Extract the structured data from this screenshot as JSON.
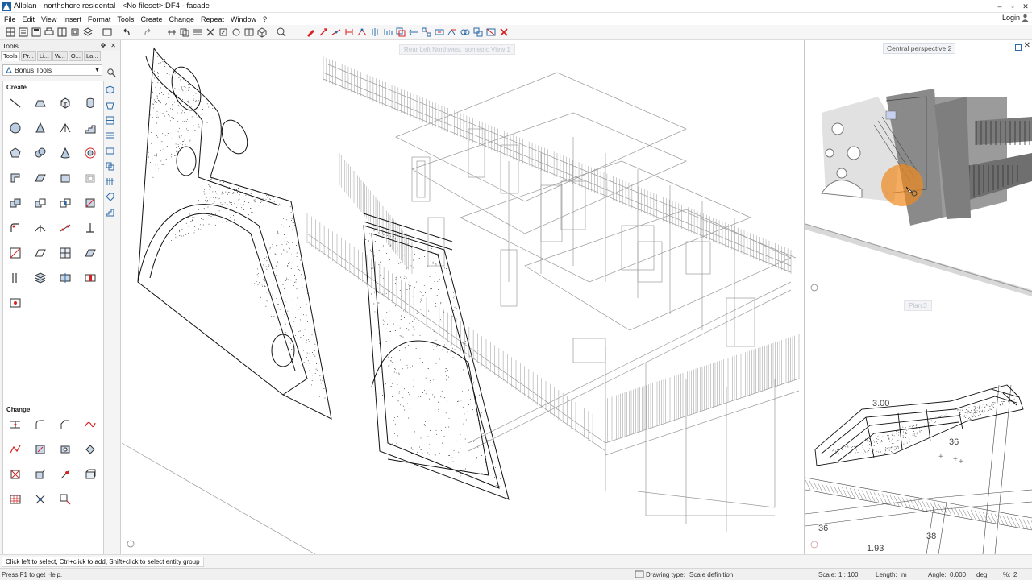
{
  "window": {
    "title": "Allplan - northshore residental - <No fileset>:DF4 - facade",
    "controls": {
      "minimize": "–",
      "maximize": "▫",
      "close": "✕"
    }
  },
  "menu": {
    "items": [
      "File",
      "Edit",
      "View",
      "Insert",
      "Format",
      "Tools",
      "Create",
      "Change",
      "Repeat",
      "Window",
      "?"
    ],
    "login": "Login"
  },
  "tools_panel": {
    "header": "Tools",
    "header_controls": {
      "pin": "✥",
      "close": "✕"
    },
    "tabs": [
      "Tools",
      "Pr...",
      "Li...",
      "W...",
      "O...",
      "La..."
    ],
    "family": "Bonus Tools",
    "create_label": "Create",
    "change_label": "Change"
  },
  "viewports": {
    "main_label": "Rear Left Northwest Isometric View 1",
    "perspective_label": "Central perspective:2",
    "plan_label": "Plan:3",
    "plan_dimensions": [
      "3.00",
      "36",
      "36",
      "38",
      "1.93"
    ]
  },
  "hint": "Click left to select, Ctrl+click to add, Shift+click to select entity group",
  "status": {
    "help": "Press F1 to get Help.",
    "drawing_type_label": "Drawing type:",
    "drawing_type_value": "Scale definition",
    "scale_label": "Scale:",
    "scale_value": "1 : 100",
    "length_label": "Length:",
    "length_value": "m",
    "angle_label": "Angle:",
    "angle_value": "0.000",
    "angle_unit": "deg",
    "percent_label": "%:",
    "percent_value": "2"
  },
  "colors": {
    "accent_red": "#d82020",
    "accent_blue": "#2b6aa8",
    "wire_gray": "#9a9a9a",
    "orange_cursor": "#f08a1c"
  }
}
